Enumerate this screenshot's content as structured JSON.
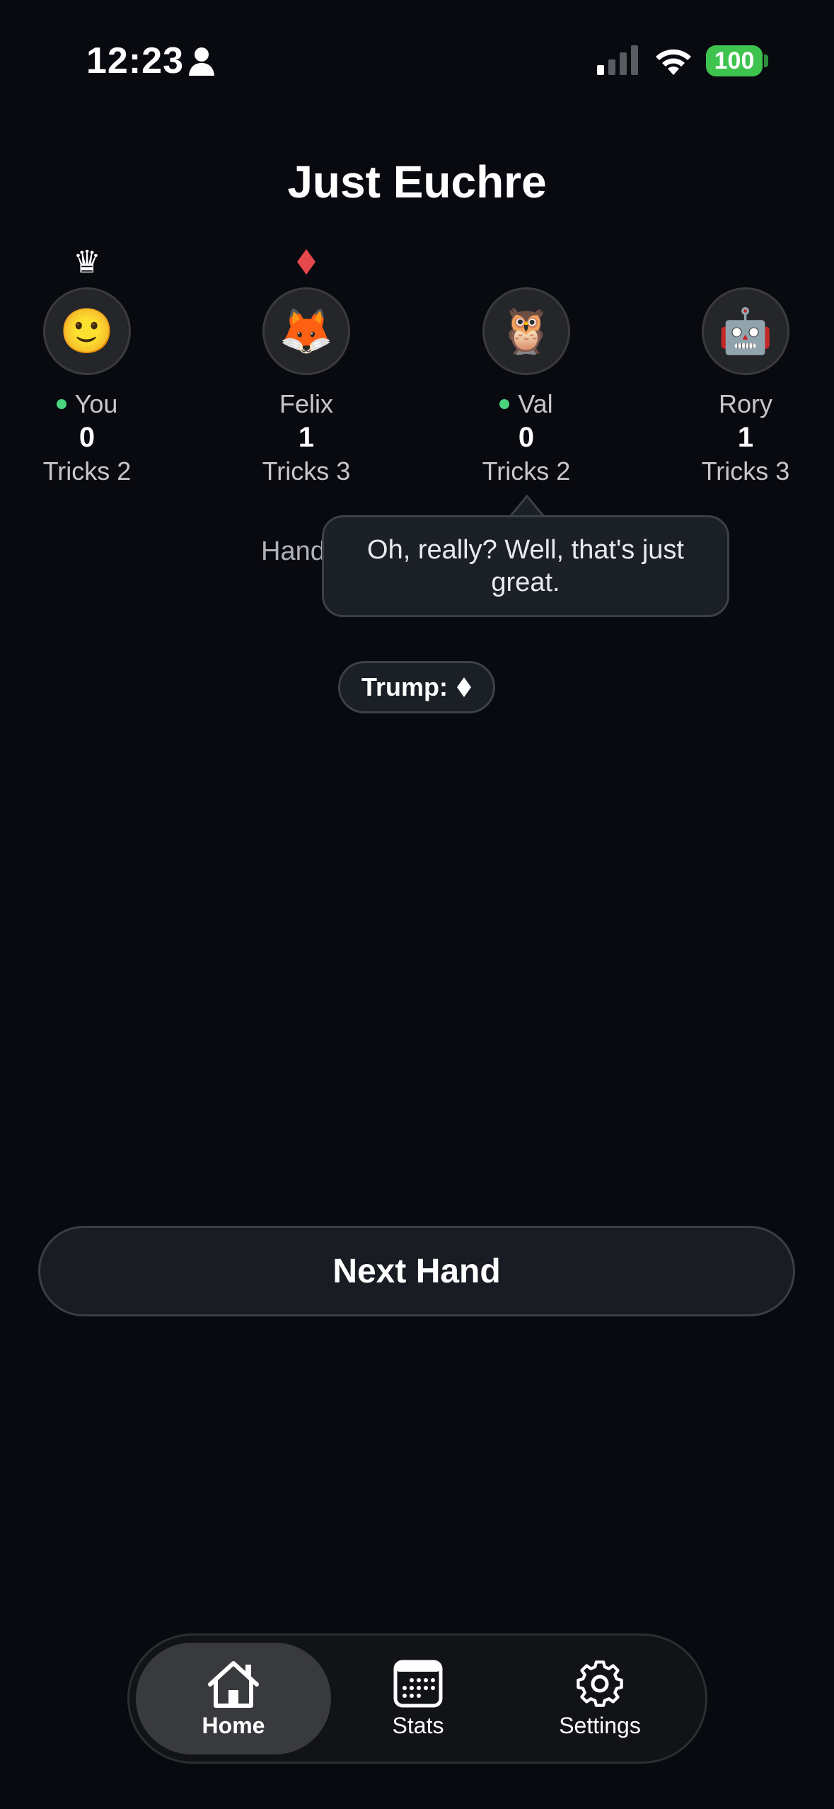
{
  "status_bar": {
    "time": "12:23",
    "battery": "100",
    "icons": [
      "person-icon",
      "cellular-signal-icon",
      "wifi-icon",
      "battery-icon"
    ]
  },
  "app": {
    "title": "Just Euchre"
  },
  "players": [
    {
      "name": "You",
      "score": "0",
      "tricks": "Tricks 2",
      "avatar": "🙂",
      "badge": "♛",
      "badge_icon": "crown-icon",
      "online": true
    },
    {
      "name": "Felix",
      "score": "1",
      "tricks": "Tricks 3",
      "avatar": "🦊",
      "badge_icon": "diamond-icon",
      "badge_color": "#e5484d",
      "online": false
    },
    {
      "name": "Val",
      "score": "0",
      "tricks": "Tricks 2",
      "avatar": "🦉",
      "online": true
    },
    {
      "name": "Rory",
      "score": "1",
      "tricks": "Tricks 3",
      "avatar": "🤖",
      "online": false
    }
  ],
  "table": {
    "hand_message": "Hand over. Trum",
    "speech_bubble": "Oh, really? Well, that's just great.",
    "trump_label": "Trump:",
    "trump_suit_icon": "diamond-icon"
  },
  "actions": {
    "next_hand_label": "Next Hand"
  },
  "tab_bar": {
    "tabs": [
      {
        "label": "Home",
        "icon": "home-icon",
        "active": true
      },
      {
        "label": "Stats",
        "icon": "calendar-icon",
        "active": false
      },
      {
        "label": "Settings",
        "icon": "gear-icon",
        "active": false
      }
    ]
  },
  "colors": {
    "background": "#080a10",
    "online_dot": "#4ad47e",
    "battery": "#3fc34f",
    "diamond_badge": "#e5484d"
  }
}
